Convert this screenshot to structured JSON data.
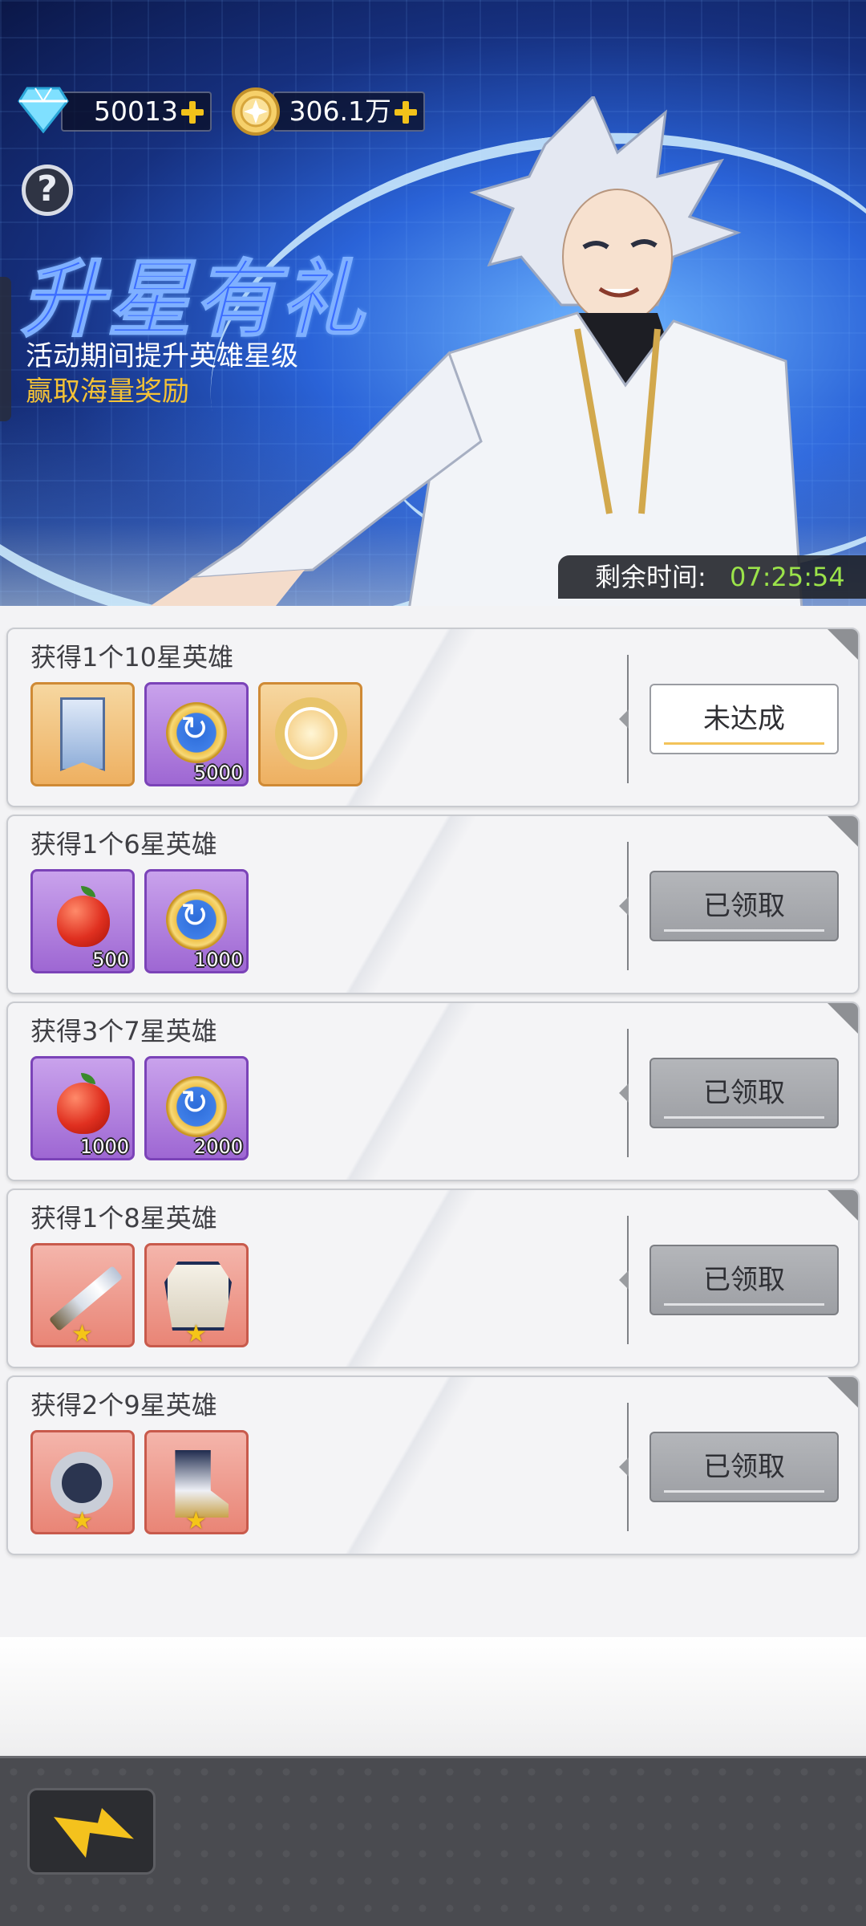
{
  "resources": {
    "diamonds": "50013",
    "gold": "306.1万"
  },
  "banner": {
    "title": "升星有礼",
    "subtitle1": "活动期间提升英雄星级",
    "subtitle2": "赢取海量奖励",
    "help_icon": "?",
    "timer_label": "剩余时间:",
    "timer_value": "07:25:54"
  },
  "tasks": [
    {
      "title": "获得1个10星英雄",
      "status": "未达成",
      "rewards": [
        {
          "icon": "banner-scroll-icon",
          "rarity": "orange",
          "qty": ""
        },
        {
          "icon": "medal-coin-icon",
          "rarity": "purple",
          "qty": "5000"
        },
        {
          "icon": "golden-ring-icon",
          "rarity": "orange",
          "qty": ""
        }
      ]
    },
    {
      "title": "获得1个6星英雄",
      "status": "已领取",
      "rewards": [
        {
          "icon": "apple-icon",
          "rarity": "purple",
          "qty": "500"
        },
        {
          "icon": "medal-coin-icon",
          "rarity": "purple",
          "qty": "1000"
        }
      ]
    },
    {
      "title": "获得3个7星英雄",
      "status": "已领取",
      "rewards": [
        {
          "icon": "apple-icon",
          "rarity": "purple",
          "qty": "1000"
        },
        {
          "icon": "medal-coin-icon",
          "rarity": "purple",
          "qty": "2000"
        }
      ]
    },
    {
      "title": "获得1个8星英雄",
      "status": "已领取",
      "rewards": [
        {
          "icon": "sword-icon",
          "rarity": "red",
          "qty": ""
        },
        {
          "icon": "armor-icon",
          "rarity": "red",
          "qty": ""
        }
      ]
    },
    {
      "title": "获得2个9星英雄",
      "status": "已领取",
      "rewards": [
        {
          "icon": "dark-ring-icon",
          "rarity": "red",
          "qty": ""
        },
        {
          "icon": "boots-icon",
          "rarity": "red",
          "qty": ""
        }
      ]
    }
  ],
  "colors": {
    "timer_value": "#9be34a",
    "subtitle_highlight": "#f4c236",
    "plus_icon": "#f2c21a"
  }
}
